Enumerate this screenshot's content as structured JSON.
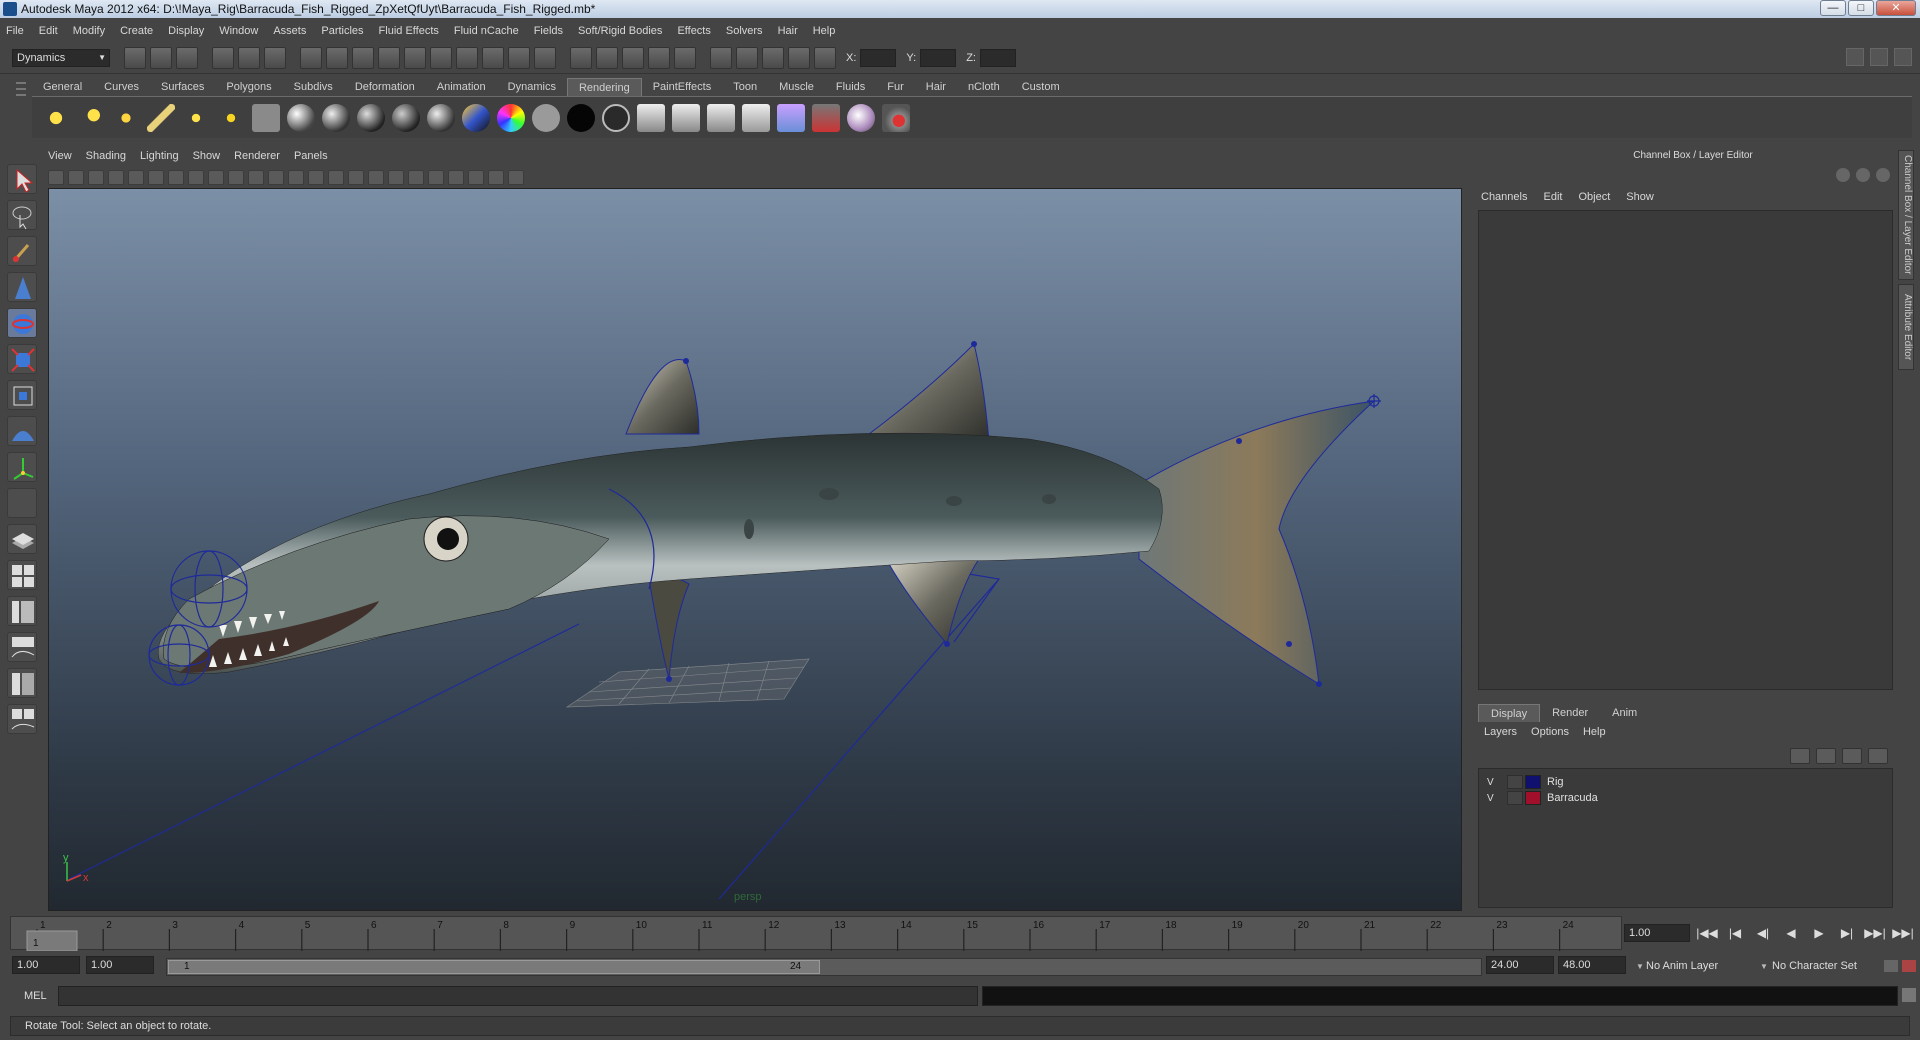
{
  "window": {
    "title": "Autodesk Maya 2012 x64: D:\\!Maya_Rig\\Barracuda_Fish_Rigged_ZpXetQfUyt\\Barracuda_Fish_Rigged.mb*",
    "controls": [
      "—",
      "□",
      "✕"
    ]
  },
  "menubar": [
    "File",
    "Edit",
    "Modify",
    "Create",
    "Display",
    "Window",
    "Assets",
    "Particles",
    "Fluid Effects",
    "Fluid nCache",
    "Fields",
    "Soft/Rigid Bodies",
    "Effects",
    "Solvers",
    "Hair",
    "Help"
  ],
  "statusline": {
    "mode": "Dynamics",
    "x_label": "X:",
    "y_label": "Y:",
    "z_label": "Z:"
  },
  "shelf": {
    "tabs": [
      "General",
      "Curves",
      "Surfaces",
      "Polygons",
      "Subdivs",
      "Deformation",
      "Animation",
      "Dynamics",
      "Rendering",
      "PaintEffects",
      "Toon",
      "Muscle",
      "Fluids",
      "Fur",
      "Hair",
      "nCloth",
      "Custom"
    ],
    "active_tab": "Rendering"
  },
  "viewport": {
    "menu": [
      "View",
      "Shading",
      "Lighting",
      "Show",
      "Renderer",
      "Panels"
    ],
    "camera_label": "persp",
    "axis_y": "y",
    "axis_x": "x"
  },
  "channel_box": {
    "title": "Channel Box / Layer Editor",
    "menu": [
      "Channels",
      "Edit",
      "Object",
      "Show"
    ],
    "side_tabs": [
      "Channel Box / Layer Editor",
      "Attribute Editor"
    ]
  },
  "layer_editor": {
    "tabs": [
      "Display",
      "Render",
      "Anim"
    ],
    "active_tab": "Display",
    "menu": [
      "Layers",
      "Options",
      "Help"
    ],
    "layers": [
      {
        "visible": "V",
        "color": "#10106e",
        "name": "Rig"
      },
      {
        "visible": "V",
        "color": "#a0102a",
        "name": "Barracuda"
      }
    ]
  },
  "timeline": {
    "frames": [
      "1",
      "2",
      "3",
      "4",
      "5",
      "6",
      "7",
      "8",
      "9",
      "10",
      "11",
      "12",
      "13",
      "14",
      "15",
      "16",
      "17",
      "18",
      "19",
      "20",
      "21",
      "22",
      "23",
      "24"
    ],
    "current_frame_marker": "1",
    "current_frame_field": "1.00",
    "playback_buttons": [
      "|◀◀",
      "|◀",
      "◀|",
      "◀",
      "▶",
      "▶|",
      "▶▶|",
      "▶▶|"
    ]
  },
  "range": {
    "start_time": "1.00",
    "playback_start": "1.00",
    "range_start_label": "1",
    "range_end_label": "24",
    "playback_end": "24.00",
    "end_time": "48.00",
    "anim_layer": "No Anim Layer",
    "character_set": "No Character Set"
  },
  "command_line": {
    "label": "MEL"
  },
  "help_line": "Rotate Tool: Select an object to rotate."
}
